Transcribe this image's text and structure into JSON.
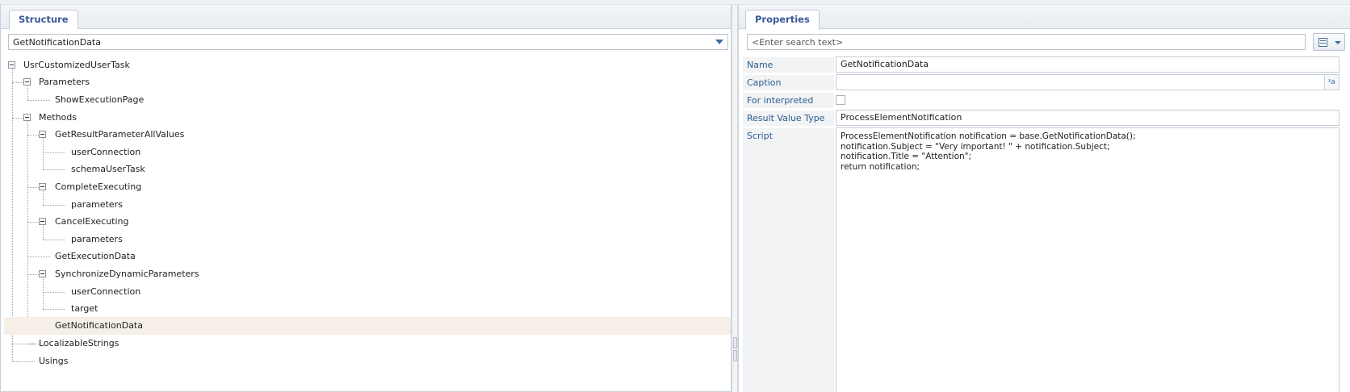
{
  "structure": {
    "tab_label": "Structure",
    "selector_value": "GetNotificationData",
    "tree": {
      "root": "UsrCustomizedUserTask",
      "parameters": "Parameters",
      "show_execution_page": "ShowExecutionPage",
      "methods": "Methods",
      "get_result_parameter_all_values": "GetResultParameterAllValues",
      "user_connection_1": "userConnection",
      "schema_user_task": "schemaUserTask",
      "complete_executing": "CompleteExecuting",
      "parameters_1": "parameters",
      "cancel_executing": "CancelExecuting",
      "parameters_2": "parameters",
      "get_execution_data": "GetExecutionData",
      "synchronize_dynamic_parameters": "SynchronizeDynamicParameters",
      "user_connection_2": "userConnection",
      "target": "target",
      "get_notification_data": "GetNotificationData",
      "localizable_strings": "LocalizableStrings",
      "usings": "Usings"
    }
  },
  "properties": {
    "tab_label": "Properties",
    "search_placeholder": "<Enter search text>",
    "name_label": "Name",
    "name_value": "GetNotificationData",
    "caption_label": "Caption",
    "caption_value": "",
    "localize_icon": "ᵡa",
    "interpreted_label": "For interpreted process",
    "interpreted_checked": false,
    "result_type_label": "Result Value Type",
    "result_type_value": "ProcessElementNotification",
    "script_label": "Script",
    "script_value": "ProcessElementNotification notification = base.GetNotificationData();\nnotification.Subject = \"Very important! \" + notification.Subject;\nnotification.Title = \"Attention\";\nreturn notification;"
  },
  "icons": {
    "view_menu": "grid-view-icon",
    "dropdown": "chevron-down-icon"
  },
  "colors": {
    "accent": "#3b5998",
    "label_blue": "#2d5c8f",
    "selected_row": "#f5efe8"
  }
}
